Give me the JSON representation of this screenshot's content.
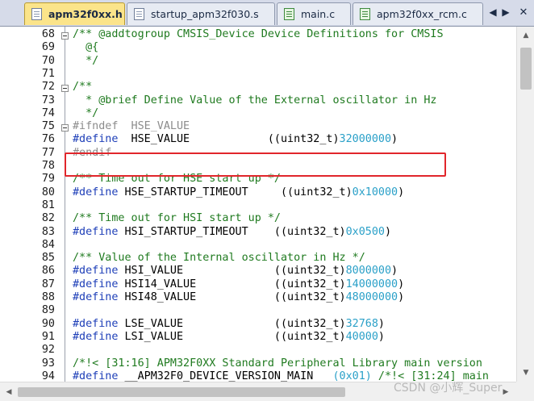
{
  "tabs": [
    {
      "label": "apm32f0xx.h",
      "active": true,
      "icon": "header-file-icon"
    },
    {
      "label": "startup_apm32f030.s",
      "active": false,
      "icon": "asm-file-icon"
    },
    {
      "label": "main.c",
      "active": false,
      "icon": "c-file-icon"
    },
    {
      "label": "apm32f0xx_rcm.c",
      "active": false,
      "icon": "c-file-icon"
    }
  ],
  "tab_controls": {
    "prev": "◀",
    "next": "▶",
    "close": "✕"
  },
  "editor": {
    "lines": [
      {
        "n": "68",
        "fold": true,
        "segs": [
          [
            "cm",
            "/** @addtogroup CMSIS_Device Device Definitions for CMSIS"
          ]
        ]
      },
      {
        "n": "69",
        "fold": false,
        "segs": [
          [
            "cm",
            "  @{"
          ]
        ]
      },
      {
        "n": "70",
        "fold": false,
        "segs": [
          [
            "cm",
            "  */"
          ]
        ]
      },
      {
        "n": "71",
        "fold": false,
        "segs": []
      },
      {
        "n": "72",
        "fold": true,
        "segs": [
          [
            "cm",
            "/**"
          ]
        ]
      },
      {
        "n": "73",
        "fold": false,
        "segs": [
          [
            "cm",
            "  * @brief Define Value of the External oscillator in Hz"
          ]
        ]
      },
      {
        "n": "74",
        "fold": false,
        "segs": [
          [
            "cm",
            "  */"
          ]
        ]
      },
      {
        "n": "75",
        "fold": true,
        "segs": [
          [
            "pp-dim",
            "#ifndef  HSE_VALUE"
          ]
        ]
      },
      {
        "n": "76",
        "fold": false,
        "segs": [
          [
            "pp",
            "#define"
          ],
          [
            "tx",
            "  HSE_VALUE            ((uint32_t)"
          ],
          [
            "nm",
            "32000000"
          ],
          [
            "tx",
            ")"
          ]
        ]
      },
      {
        "n": "77",
        "fold": false,
        "segs": [
          [
            "pp-dim",
            "#endif"
          ]
        ]
      },
      {
        "n": "78",
        "fold": false,
        "segs": []
      },
      {
        "n": "79",
        "fold": false,
        "segs": [
          [
            "cm",
            "/** Time out for HSE start up */"
          ]
        ]
      },
      {
        "n": "80",
        "fold": false,
        "segs": [
          [
            "pp",
            "#define"
          ],
          [
            "tx",
            " HSE_STARTUP_TIMEOUT     ((uint32_t)"
          ],
          [
            "nm",
            "0x10000"
          ],
          [
            "tx",
            ")"
          ]
        ]
      },
      {
        "n": "81",
        "fold": false,
        "segs": []
      },
      {
        "n": "82",
        "fold": false,
        "segs": [
          [
            "cm",
            "/** Time out for HSI start up */"
          ]
        ]
      },
      {
        "n": "83",
        "fold": false,
        "segs": [
          [
            "pp",
            "#define"
          ],
          [
            "tx",
            " HSI_STARTUP_TIMEOUT    ((uint32_t)"
          ],
          [
            "nm",
            "0x0500"
          ],
          [
            "tx",
            ")"
          ]
        ]
      },
      {
        "n": "84",
        "fold": false,
        "segs": []
      },
      {
        "n": "85",
        "fold": false,
        "segs": [
          [
            "cm",
            "/** Value of the Internal oscillator in Hz */"
          ]
        ]
      },
      {
        "n": "86",
        "fold": false,
        "segs": [
          [
            "pp",
            "#define"
          ],
          [
            "tx",
            " HSI_VALUE              ((uint32_t)"
          ],
          [
            "nm",
            "8000000"
          ],
          [
            "tx",
            ")"
          ]
        ]
      },
      {
        "n": "87",
        "fold": false,
        "segs": [
          [
            "pp",
            "#define"
          ],
          [
            "tx",
            " HSI14_VALUE            ((uint32_t)"
          ],
          [
            "nm",
            "14000000"
          ],
          [
            "tx",
            ")"
          ]
        ]
      },
      {
        "n": "88",
        "fold": false,
        "segs": [
          [
            "pp",
            "#define"
          ],
          [
            "tx",
            " HSI48_VALUE            ((uint32_t)"
          ],
          [
            "nm",
            "48000000"
          ],
          [
            "tx",
            ")"
          ]
        ]
      },
      {
        "n": "89",
        "fold": false,
        "segs": []
      },
      {
        "n": "90",
        "fold": false,
        "segs": [
          [
            "pp",
            "#define"
          ],
          [
            "tx",
            " LSE_VALUE              ((uint32_t)"
          ],
          [
            "nm",
            "32768"
          ],
          [
            "tx",
            ")"
          ]
        ]
      },
      {
        "n": "91",
        "fold": false,
        "segs": [
          [
            "pp",
            "#define"
          ],
          [
            "tx",
            " LSI_VALUE              ((uint32_t)"
          ],
          [
            "nm",
            "40000"
          ],
          [
            "tx",
            ")"
          ]
        ]
      },
      {
        "n": "92",
        "fold": false,
        "segs": []
      },
      {
        "n": "93",
        "fold": false,
        "segs": [
          [
            "cm",
            "/*!< [31:16] APM32F0XX Standard Peripheral Library main version"
          ]
        ]
      },
      {
        "n": "94",
        "fold": false,
        "segs": [
          [
            "pp",
            "#define"
          ],
          [
            "tx",
            " __APM32F0_DEVICE_VERSION_MAIN   "
          ],
          [
            "nm",
            "(0x01)"
          ],
          [
            "cm",
            " /*!< [31:24] main"
          ]
        ]
      }
    ]
  },
  "highlight": {
    "line": "76",
    "color": "#e1262b"
  },
  "scrollbars": {
    "up": "▲",
    "down": "▼",
    "left": "◀",
    "right": "▶"
  },
  "watermark": "CSDN @小辉_Super",
  "colors": {
    "comment": "#1f7a1f",
    "preprocessor": "#1e3fb8",
    "inactive_preprocessor": "#8c8c8c",
    "number": "#2aa0c8",
    "active_tab": "#fbe48a"
  }
}
